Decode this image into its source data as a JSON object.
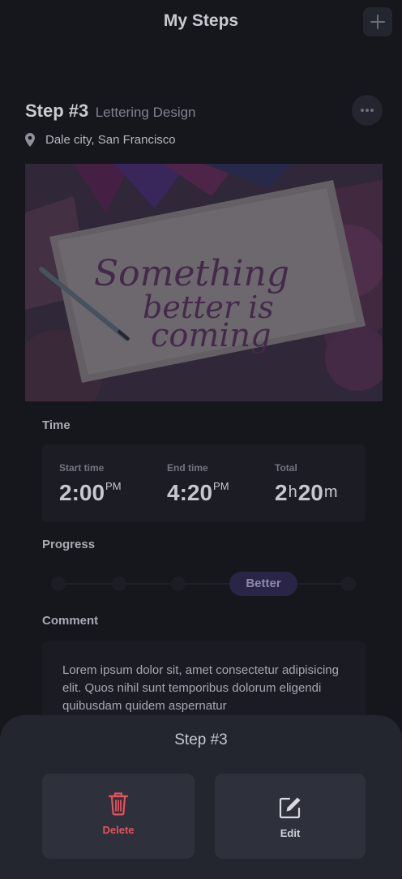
{
  "header": {
    "title": "My Steps",
    "add_icon": "plus-icon"
  },
  "step": {
    "number": "Step #3",
    "name": "Lettering Design",
    "more_icon": "ellipsis-icon",
    "location_icon": "map-pin-icon",
    "location": "Dale city, San Francisco",
    "image_text": [
      "Something",
      "better is",
      "coming"
    ]
  },
  "time": {
    "label": "Time",
    "start": {
      "label": "Start time",
      "value": "2:00",
      "suffix": "PM"
    },
    "end": {
      "label": "End time",
      "value": "4:20",
      "suffix": "PM"
    },
    "total": {
      "label": "Total",
      "hours": "2",
      "hours_unit": "h",
      "minutes": "20",
      "minutes_unit": "m"
    }
  },
  "progress": {
    "label": "Progress",
    "current": "Better",
    "active_index": 3,
    "steps_count": 5
  },
  "comment": {
    "label": "Comment",
    "text": "Lorem ipsum dolor sit, amet consectetur adipisicing elit. Quos nihil sunt temporibus dolorum eligendi quibusdam quidem aspernatur"
  },
  "sheet": {
    "title": "Step #3",
    "delete_label": "Delete",
    "delete_icon": "trash-icon",
    "edit_label": "Edit",
    "edit_icon": "edit-icon"
  },
  "colors": {
    "background": "#16171d",
    "sheet": "#24262f",
    "danger": "#e4525c",
    "accent": "#2a2447"
  }
}
